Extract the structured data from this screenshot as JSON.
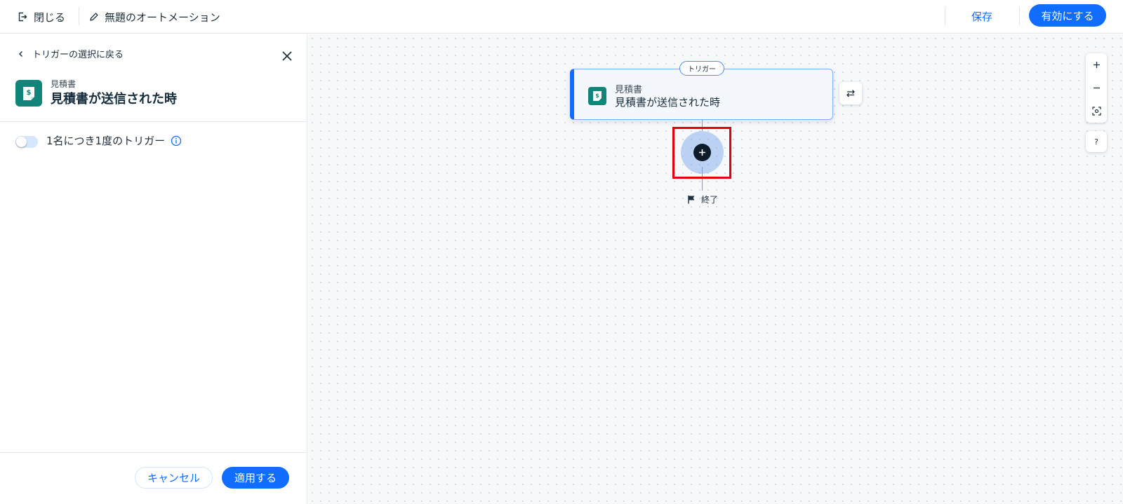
{
  "header": {
    "close_label": "閉じる",
    "automation_title": "無題のオートメーション",
    "save_label": "保存",
    "activate_label": "有効にする"
  },
  "panel": {
    "back_label": "トリガーの選択に戻る",
    "app_name": "見積書",
    "trigger_name": "見積書が送信された時",
    "toggle_label": "1名につき1度のトリガー",
    "toggle_on": false,
    "cancel_label": "キャンセル",
    "apply_label": "適用する"
  },
  "canvas": {
    "trigger_badge": "トリガー",
    "node_app_name": "見積書",
    "node_trigger_name": "見積書が送信された時",
    "end_label": "終了",
    "help_label": "?"
  },
  "colors": {
    "accent": "#116dff",
    "app_icon": "#12857a",
    "highlight": "#e2000f",
    "canvas_bg": "#f7f8fa"
  },
  "icons": {
    "close": "exit-door-icon",
    "edit": "pencil-icon",
    "back": "chevron-left-icon",
    "panel_close": "close-x-icon",
    "app": "quote-document-dollar-icon",
    "info": "info-circle-icon",
    "swap": "swap-arrows-icon",
    "add": "plus-icon",
    "end": "flag-icon",
    "zoom_in": "plus-icon",
    "zoom_out": "minus-icon",
    "fit": "fit-screen-icon"
  }
}
